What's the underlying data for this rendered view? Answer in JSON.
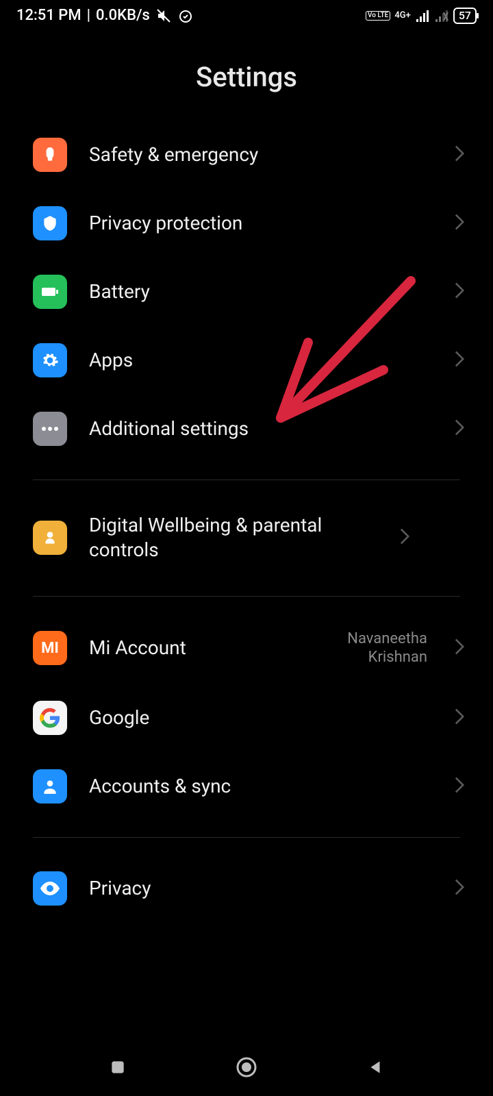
{
  "statusBar": {
    "time": "12:51 PM",
    "dataRate": "0.0KB/s",
    "networkLabel": "4G+",
    "volteLabel": "Vo LTE",
    "batteryPercent": "57"
  },
  "header": {
    "title": "Settings"
  },
  "groups": [
    {
      "items": [
        {
          "key": "safety",
          "label": "Safety & emergency",
          "iconBg": "#ff6b3d",
          "icon": "safety"
        },
        {
          "key": "privacyp",
          "label": "Privacy protection",
          "iconBg": "#1e90ff",
          "icon": "shield"
        },
        {
          "key": "battery",
          "label": "Battery",
          "iconBg": "#25c05a",
          "icon": "battery"
        },
        {
          "key": "apps",
          "label": "Apps",
          "iconBg": "#1e90ff",
          "icon": "gear"
        },
        {
          "key": "addl",
          "label": "Additional settings",
          "iconBg": "#8c8c94",
          "icon": "dots"
        }
      ]
    },
    {
      "items": [
        {
          "key": "wellbeing",
          "label": "Digital Wellbeing & parental controls",
          "iconBg": "#f0b03a",
          "icon": "person-heart"
        }
      ]
    },
    {
      "items": [
        {
          "key": "mi",
          "label": "Mi Account",
          "iconBg": "#ff6b1a",
          "icon": "mi",
          "value": "Navaneetha\nKrishnan"
        },
        {
          "key": "google",
          "label": "Google",
          "iconBg": "#f5f5f5",
          "icon": "google"
        },
        {
          "key": "accounts",
          "label": "Accounts & sync",
          "iconBg": "#1e90ff",
          "icon": "person"
        }
      ]
    },
    {
      "items": [
        {
          "key": "privacy",
          "label": "Privacy",
          "iconBg": "#1e90ff",
          "icon": "eye"
        }
      ]
    }
  ],
  "annotation": {
    "arrowColor": "#d8263e"
  }
}
